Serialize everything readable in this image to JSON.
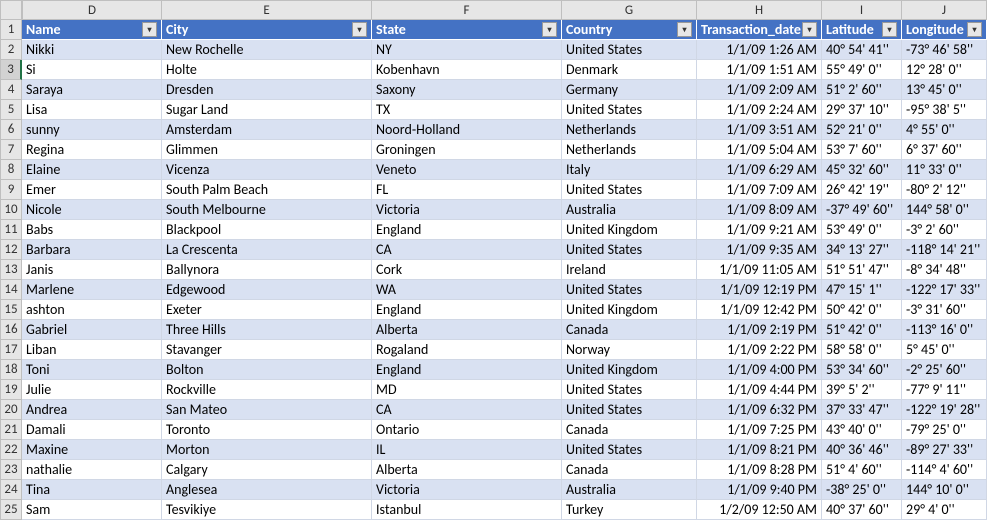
{
  "columns": [
    "D",
    "E",
    "F",
    "G",
    "H",
    "I",
    "J"
  ],
  "rowStart": 1,
  "selectedRowHeader": 3,
  "headers": [
    "Name",
    "City",
    "State",
    "Country",
    "Transaction_date",
    "Latitude",
    "Longitude"
  ],
  "rows": [
    {
      "n": 2,
      "name": "Nikki",
      "city": "New Rochelle",
      "state": "NY",
      "country": "United States",
      "tdate": "1/1/09 1:26 AM",
      "lat": "40° 54'  41''",
      "lon": "-73° 46' 58''"
    },
    {
      "n": 3,
      "name": "Si",
      "city": "Holte",
      "state": "Kobenhavn",
      "country": "Denmark",
      "tdate": "1/1/09 1:51 AM",
      "lat": "55° 49'  0''",
      "lon": "12° 28' 0''"
    },
    {
      "n": 4,
      "name": "Saraya",
      "city": "Dresden",
      "state": "Saxony",
      "country": "Germany",
      "tdate": "1/1/09 2:09 AM",
      "lat": "51° 2'  60''",
      "lon": "13° 45' 0''"
    },
    {
      "n": 5,
      "name": "Lisa",
      "city": "Sugar Land",
      "state": "TX",
      "country": "United States",
      "tdate": "1/1/09 2:24 AM",
      "lat": "29° 37'  10''",
      "lon": "-95° 38' 5''"
    },
    {
      "n": 6,
      "name": "sunny",
      "city": "Amsterdam",
      "state": "Noord-Holland",
      "country": "Netherlands",
      "tdate": "1/1/09 3:51 AM",
      "lat": "52° 21'  0''",
      "lon": "4° 55' 0''"
    },
    {
      "n": 7,
      "name": "Regina",
      "city": "Glimmen",
      "state": "Groningen",
      "country": "Netherlands",
      "tdate": "1/1/09 5:04 AM",
      "lat": "53° 7'  60''",
      "lon": "6° 37' 60''"
    },
    {
      "n": 8,
      "name": "Elaine",
      "city": "Vicenza",
      "state": "Veneto",
      "country": "Italy",
      "tdate": "1/1/09 6:29 AM",
      "lat": "45° 32'  60''",
      "lon": "11° 33' 0''"
    },
    {
      "n": 9,
      "name": "Emer",
      "city": "South Palm Beach",
      "state": "FL",
      "country": "United States",
      "tdate": "1/1/09 7:09 AM",
      "lat": "26° 42'  19''",
      "lon": "-80° 2' 12''"
    },
    {
      "n": 10,
      "name": "Nicole",
      "city": "South Melbourne",
      "state": "Victoria",
      "country": "Australia",
      "tdate": "1/1/09 8:09 AM",
      "lat": "-37° 49'  60''",
      "lon": "144° 58' 0''"
    },
    {
      "n": 11,
      "name": "Babs",
      "city": "Blackpool",
      "state": "England",
      "country": "United Kingdom",
      "tdate": "1/1/09 9:21 AM",
      "lat": "53° 49'  0''",
      "lon": "-3° 2' 60''"
    },
    {
      "n": 12,
      "name": "Barbara",
      "city": "La Crescenta",
      "state": "CA",
      "country": "United States",
      "tdate": "1/1/09 9:35 AM",
      "lat": "34° 13'  27''",
      "lon": "-118° 14' 21''"
    },
    {
      "n": 13,
      "name": "Janis",
      "city": "Ballynora",
      "state": "Cork",
      "country": "Ireland",
      "tdate": "1/1/09 11:05 AM",
      "lat": "51° 51'  47''",
      "lon": "-8° 34' 48''"
    },
    {
      "n": 14,
      "name": "Marlene",
      "city": "Edgewood",
      "state": "WA",
      "country": "United States",
      "tdate": "1/1/09 12:19 PM",
      "lat": "47° 15'  1''",
      "lon": "-122° 17' 33''"
    },
    {
      "n": 15,
      "name": "ashton",
      "city": "Exeter",
      "state": "England",
      "country": "United Kingdom",
      "tdate": "1/1/09 12:42 PM",
      "lat": "50° 42'  0''",
      "lon": "-3° 31' 60''"
    },
    {
      "n": 16,
      "name": "Gabriel",
      "city": "Three Hills",
      "state": "Alberta",
      "country": "Canada",
      "tdate": "1/1/09 2:19 PM",
      "lat": "51° 42'  0''",
      "lon": "-113° 16' 0''"
    },
    {
      "n": 17,
      "name": "Liban",
      "city": "Stavanger",
      "state": "Rogaland",
      "country": "Norway",
      "tdate": "1/1/09 2:22 PM",
      "lat": "58° 58'  0''",
      "lon": "5° 45' 0''"
    },
    {
      "n": 18,
      "name": "Toni",
      "city": "Bolton",
      "state": "England",
      "country": "United Kingdom",
      "tdate": "1/1/09 4:00 PM",
      "lat": "53° 34'  60''",
      "lon": "-2° 25' 60''"
    },
    {
      "n": 19,
      "name": "Julie",
      "city": "Rockville",
      "state": "MD",
      "country": "United States",
      "tdate": "1/1/09 4:44 PM",
      "lat": "39° 5'  2''",
      "lon": "-77° 9' 11''"
    },
    {
      "n": 20,
      "name": "Andrea",
      "city": "San Mateo",
      "state": "CA",
      "country": "United States",
      "tdate": "1/1/09 6:32 PM",
      "lat": "37° 33'  47''",
      "lon": "-122° 19' 28''"
    },
    {
      "n": 21,
      "name": "Damali",
      "city": "Toronto",
      "state": "Ontario",
      "country": "Canada",
      "tdate": "1/1/09 7:25 PM",
      "lat": "43° 40'  0''",
      "lon": "-79° 25' 0''"
    },
    {
      "n": 22,
      "name": "Maxine",
      "city": "Morton",
      "state": "IL",
      "country": "United States",
      "tdate": "1/1/09 8:21 PM",
      "lat": "40° 36'  46''",
      "lon": "-89° 27' 33''"
    },
    {
      "n": 23,
      "name": "nathalie",
      "city": "Calgary",
      "state": "Alberta",
      "country": "Canada",
      "tdate": "1/1/09 8:28 PM",
      "lat": "51° 4'  60''",
      "lon": "-114° 4' 60''"
    },
    {
      "n": 24,
      "name": "Tina",
      "city": "Anglesea",
      "state": "Victoria",
      "country": "Australia",
      "tdate": "1/1/09 9:40 PM",
      "lat": "-38° 25'  0''",
      "lon": "144° 10' 0''"
    },
    {
      "n": 25,
      "name": "Sam",
      "city": "Tesvikiye",
      "state": "Istanbul",
      "country": "Turkey",
      "tdate": "1/2/09 12:50 AM",
      "lat": "40° 37'  60''",
      "lon": "29° 4' 0''"
    }
  ]
}
